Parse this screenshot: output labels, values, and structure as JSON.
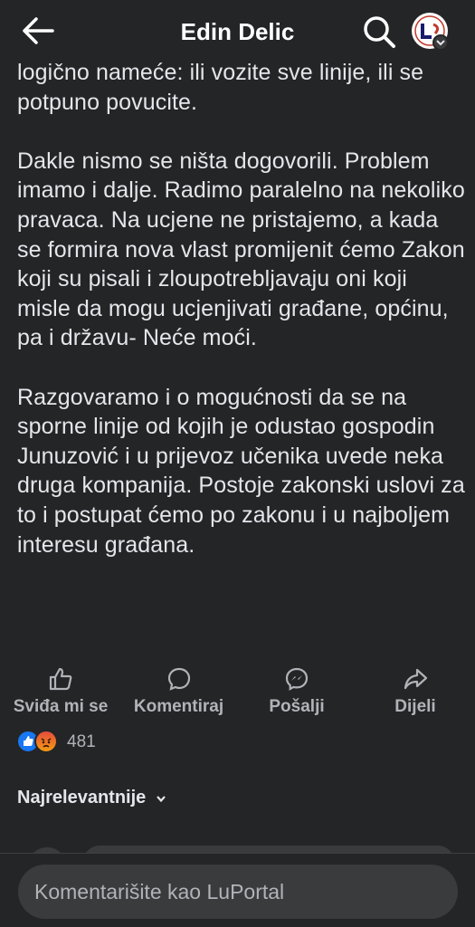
{
  "header": {
    "title": "Edin Delic",
    "back_icon": "arrow-left-icon",
    "search_icon": "search-icon",
    "avatar_alt": "LuPortal"
  },
  "post": {
    "paragraphs": [
      "logično nameće: ili vozite sve linije, ili se potpuno povucite.",
      "Dakle nismo se ništa dogovorili. Problem imamo i dalje. Radimo paralelno na nekoliko pravaca. Na ucjene ne pristajemo, a kada se formira nova vlast promijenit ćemo Zakon koji su pisali i zloupotrebljavaju oni koji misle da mogu ucjenjivati građane, općinu, pa i državu- Neće moći.",
      "Razgovaramo i o mogućnosti da se na sporne linije od kojih je odustao gospodin Junuzović i u prijevoz učenika uvede neka druga kompanija. Postoje zakonski uslovi za to i postupat ćemo po zakonu i u najboljem interesu građana."
    ]
  },
  "actions": {
    "like": "Sviđa mi se",
    "comment": "Komentiraj",
    "send": "Pošalji",
    "share": "Dijeli"
  },
  "reactions": {
    "count": "481",
    "types": [
      "like",
      "angry"
    ]
  },
  "comments": {
    "sort_label": "Najrelevantnije"
  },
  "composer": {
    "placeholder": "Komentarišite kao LuPortal"
  },
  "colors": {
    "background": "#242526",
    "text": "#e4e6eb",
    "muted": "#b0b3b8",
    "like_blue": "#1877f2"
  }
}
